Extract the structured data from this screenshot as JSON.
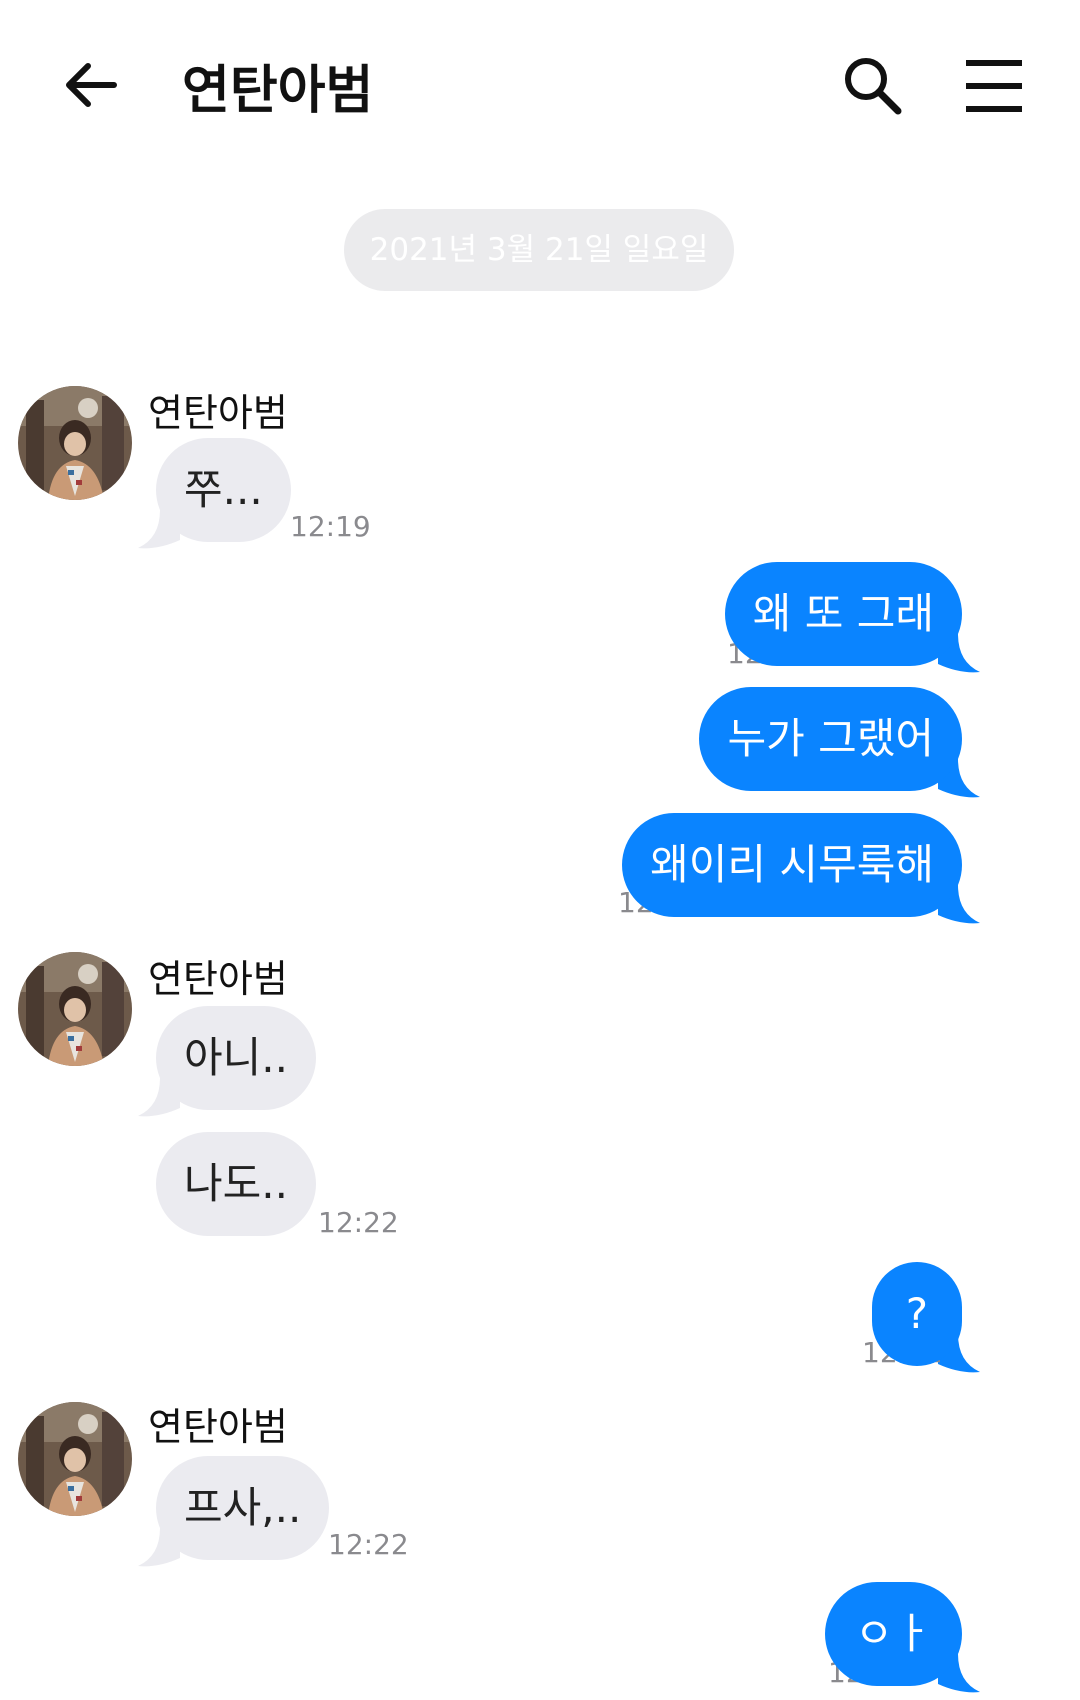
{
  "header": {
    "back_icon": "arrow-left-icon",
    "title": "연탄아범",
    "search_icon": "search-icon",
    "menu_icon": "hamburger-menu-icon"
  },
  "date_divider": "2021년 3월 21일 일요일",
  "colors": {
    "outgoing_bubble": "#0a84ff",
    "incoming_bubble": "#ebebf0",
    "timestamp": "#8a8a8e"
  },
  "messages": [
    {
      "sender": "연탄아범",
      "direction": "incoming",
      "text": "쭈...",
      "time": "12:19"
    },
    {
      "direction": "outgoing",
      "text": "왜 또 그래",
      "time": "12:19"
    },
    {
      "direction": "outgoing",
      "text": "누가 그랬어"
    },
    {
      "direction": "outgoing",
      "text": "왜이리 시무룩해",
      "time": "12:20"
    },
    {
      "sender": "연탄아범",
      "direction": "incoming",
      "text": "아니.."
    },
    {
      "direction": "incoming",
      "text": "나도..",
      "time": "12:22"
    },
    {
      "direction": "outgoing",
      "text": "?",
      "time": "12:22"
    },
    {
      "sender": "연탄아범",
      "direction": "incoming",
      "text": "프사,..",
      "time": "12:22"
    },
    {
      "direction": "outgoing",
      "text": "ㅇㅏ",
      "time": "12:22"
    }
  ]
}
